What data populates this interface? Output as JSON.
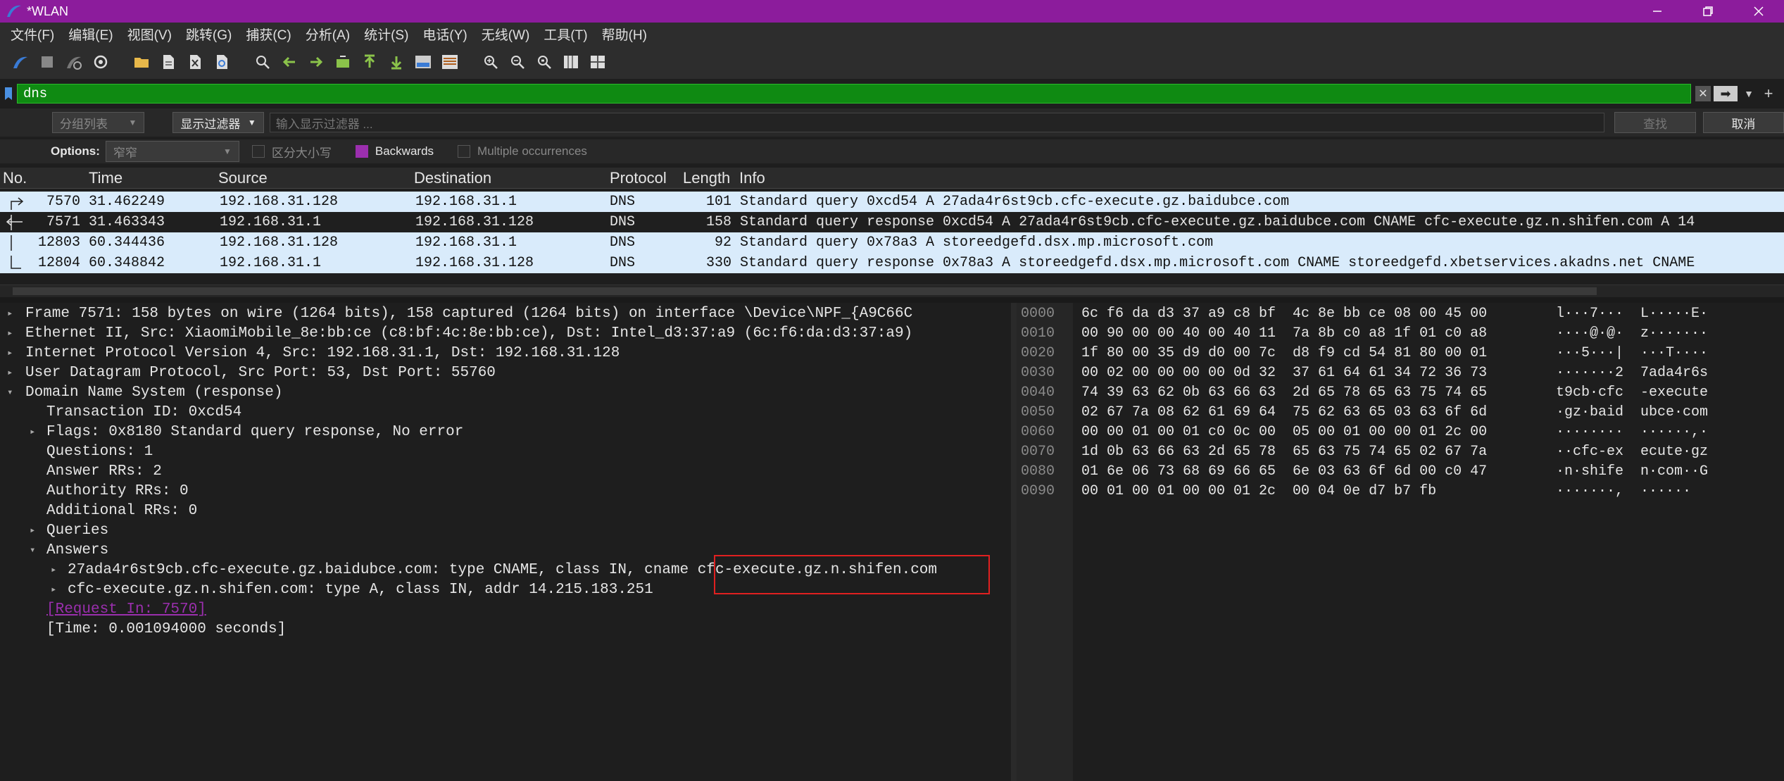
{
  "window": {
    "title": "*WLAN",
    "controls": [
      "minimize-icon",
      "restore-icon",
      "close-icon"
    ]
  },
  "menu": [
    "文件(F)",
    "编辑(E)",
    "视图(V)",
    "跳转(G)",
    "捕获(C)",
    "分析(A)",
    "统计(S)",
    "电话(Y)",
    "无线(W)",
    "工具(T)",
    "帮助(H)"
  ],
  "toolbar_icons": [
    "shark-fin-start-icon",
    "stop-icon",
    "restart-icon",
    "options-gear-icon",
    "open-folder-icon",
    "save-file-icon",
    "close-file-icon",
    "reload-icon",
    "search-icon",
    "back-arrow-icon",
    "forward-arrow-icon",
    "goto-packet-icon",
    "first-packet-icon",
    "last-packet-icon",
    "autoscroll-icon",
    "colorize-icon",
    "zoom-in-icon",
    "zoom-out-icon",
    "zoom-reset-icon",
    "resize-columns-icon",
    "layout-icon"
  ],
  "filter": {
    "value": "dns",
    "accent": "#0f8a12"
  },
  "find": {
    "scope": "分组列表",
    "type": "显示过滤器",
    "placeholder": "输入显示过滤器 ...",
    "find_label": "查找",
    "cancel_label": "取消",
    "options_label": "Options:",
    "charset": "窄窄",
    "case_label": "区分大小写",
    "backwards_label": "Backwards",
    "multiple_label": "Multiple occurrences"
  },
  "columns": [
    "No.",
    "Time",
    "Source",
    "Destination",
    "Protocol",
    "Length",
    "Info"
  ],
  "packets": [
    {
      "no": "7570",
      "time": "31.462249",
      "src": "192.168.31.128",
      "dst": "192.168.31.1",
      "proto": "DNS",
      "len": "101",
      "info": "Standard query 0xcd54 A 27ada4r6st9cb.cfc-execute.gz.baidubce.com"
    },
    {
      "no": "7571",
      "time": "31.463343",
      "src": "192.168.31.1",
      "dst": "192.168.31.128",
      "proto": "DNS",
      "len": "158",
      "info": "Standard query response 0xcd54 A 27ada4r6st9cb.cfc-execute.gz.baidubce.com CNAME cfc-execute.gz.n.shifen.com A 14"
    },
    {
      "no": "12803",
      "time": "60.344436",
      "src": "192.168.31.128",
      "dst": "192.168.31.1",
      "proto": "DNS",
      "len": "92",
      "info": "Standard query 0x78a3 A storeedgefd.dsx.mp.microsoft.com"
    },
    {
      "no": "12804",
      "time": "60.348842",
      "src": "192.168.31.1",
      "dst": "192.168.31.128",
      "proto": "DNS",
      "len": "330",
      "info": "Standard query response 0x78a3 A storeedgefd.dsx.mp.microsoft.com CNAME storeedgefd.xbetservices.akadns.net CNAME"
    }
  ],
  "details": [
    {
      "tw": "▸",
      "text": "Frame 7571: 158 bytes on wire (1264 bits), 158 captured (1264 bits) on interface \\Device\\NPF_{A9C66C"
    },
    {
      "tw": "▸",
      "text": "Ethernet II, Src: XiaomiMobile_8e:bb:ce (c8:bf:4c:8e:bb:ce), Dst: Intel_d3:37:a9 (6c:f6:da:d3:37:a9)"
    },
    {
      "tw": "▸",
      "text": "Internet Protocol Version 4, Src: 192.168.31.1, Dst: 192.168.31.128"
    },
    {
      "tw": "▸",
      "text": "User Datagram Protocol, Src Port: 53, Dst Port: 55760"
    },
    {
      "tw": "▾",
      "text": "Domain Name System (response)"
    },
    {
      "tw": "",
      "text": "Transaction ID: 0xcd54"
    },
    {
      "tw": "▸",
      "text": "Flags: 0x8180 Standard query response, No error"
    },
    {
      "tw": "",
      "text": "Questions: 1"
    },
    {
      "tw": "",
      "text": "Answer RRs: 2"
    },
    {
      "tw": "",
      "text": "Authority RRs: 0"
    },
    {
      "tw": "",
      "text": "Additional RRs: 0"
    },
    {
      "tw": "▸",
      "text": "Queries"
    },
    {
      "tw": "▾",
      "text": "Answers"
    },
    {
      "tw": "▸",
      "text": "27ada4r6st9cb.cfc-execute.gz.baidubce.com: type CNAME, class IN, cname cfc-execute.gz.n.shifen.com"
    },
    {
      "tw": "▸",
      "text": "cfc-execute.gz.n.shifen.com: type A, class IN, addr 14.215.183.251"
    },
    {
      "tw": "",
      "text": "[Request In: 7570]"
    },
    {
      "tw": "",
      "text": "[Time: 0.001094000 seconds]"
    }
  ],
  "hex": [
    {
      "off": "0000",
      "bytes": "6c f6 da d3 37 a9 c8 bf  4c 8e bb ce 08 00 45 00",
      "ascii": "l···7···  L·····E·"
    },
    {
      "off": "0010",
      "bytes": "00 90 00 00 40 00 40 11  7a 8b c0 a8 1f 01 c0 a8",
      "ascii": "····@·@·  z·······"
    },
    {
      "off": "0020",
      "bytes": "1f 80 00 35 d9 d0 00 7c  d8 f9 cd 54 81 80 00 01",
      "ascii": "···5···|  ···T····"
    },
    {
      "off": "0030",
      "bytes": "00 02 00 00 00 00 0d 32  37 61 64 61 34 72 36 73",
      "ascii": "·······2  7ada4r6s"
    },
    {
      "off": "0040",
      "bytes": "74 39 63 62 0b 63 66 63  2d 65 78 65 63 75 74 65",
      "ascii": "t9cb·cfc  -execute"
    },
    {
      "off": "0050",
      "bytes": "02 67 7a 08 62 61 69 64  75 62 63 65 03 63 6f 6d",
      "ascii": "·gz·baid  ubce·com"
    },
    {
      "off": "0060",
      "bytes": "00 00 01 00 01 c0 0c 00  05 00 01 00 00 01 2c 00",
      "ascii": "········  ······,·"
    },
    {
      "off": "0070",
      "bytes": "1d 0b 63 66 63 2d 65 78  65 63 75 74 65 02 67 7a",
      "ascii": "··cfc-ex  ecute·gz"
    },
    {
      "off": "0080",
      "bytes": "01 6e 06 73 68 69 66 65  6e 03 63 6f 6d 00 c0 47",
      "ascii": "·n·shife  n·com··G"
    },
    {
      "off": "0090",
      "bytes": "00 01 00 01 00 00 01 2c  00 04 0e d7 b7 fb",
      "ascii": "·······,  ······"
    }
  ],
  "colors": {
    "title_bg": "#8c1c9c",
    "filter_bg": "#0f8a12",
    "row_bg": "#d9ebfb",
    "highlight_box": "#e02020",
    "link": "#9b2fae"
  }
}
